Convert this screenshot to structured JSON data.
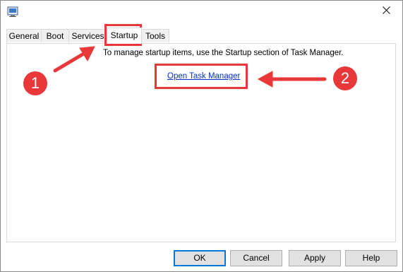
{
  "window": {
    "close_icon": "close-icon",
    "app_icon": "system-configuration-icon"
  },
  "tabs": [
    {
      "label": "General"
    },
    {
      "label": "Boot"
    },
    {
      "label": "Services"
    },
    {
      "label": "Startup",
      "active": true
    },
    {
      "label": "Tools"
    }
  ],
  "startup": {
    "message": "To manage startup items, use the Startup section of Task Manager.",
    "link_label": "Open Task Manager"
  },
  "buttons": {
    "ok": "OK",
    "cancel": "Cancel",
    "apply": "Apply",
    "help": "Help"
  },
  "annotations": {
    "badge_1": "1",
    "badge_2": "2",
    "color": "#e8383a"
  }
}
